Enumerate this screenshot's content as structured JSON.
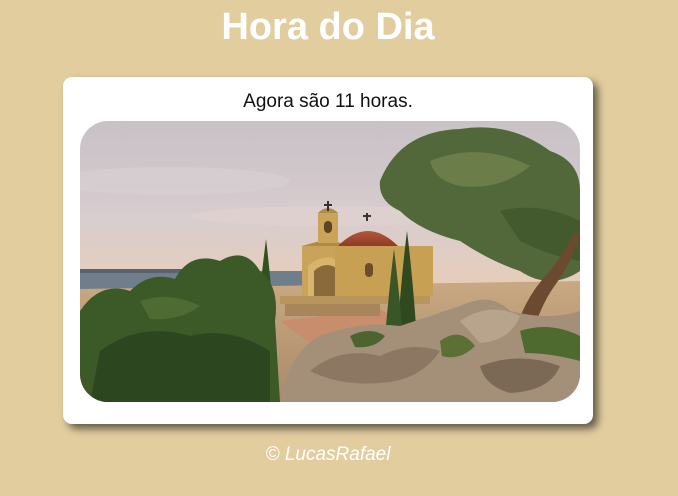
{
  "header": {
    "title": "Hora do Dia"
  },
  "card": {
    "message": "Agora são 11 horas.",
    "image": {
      "alt": "Capela com cúpula de tijolos sobre um penhasco ao entardecer, cercada por árvores e arbustos"
    }
  },
  "footer": {
    "credit": "© LucasRafael"
  },
  "colors": {
    "background": "#e2cd9f",
    "card": "#ffffff",
    "title": "#ffffff"
  }
}
